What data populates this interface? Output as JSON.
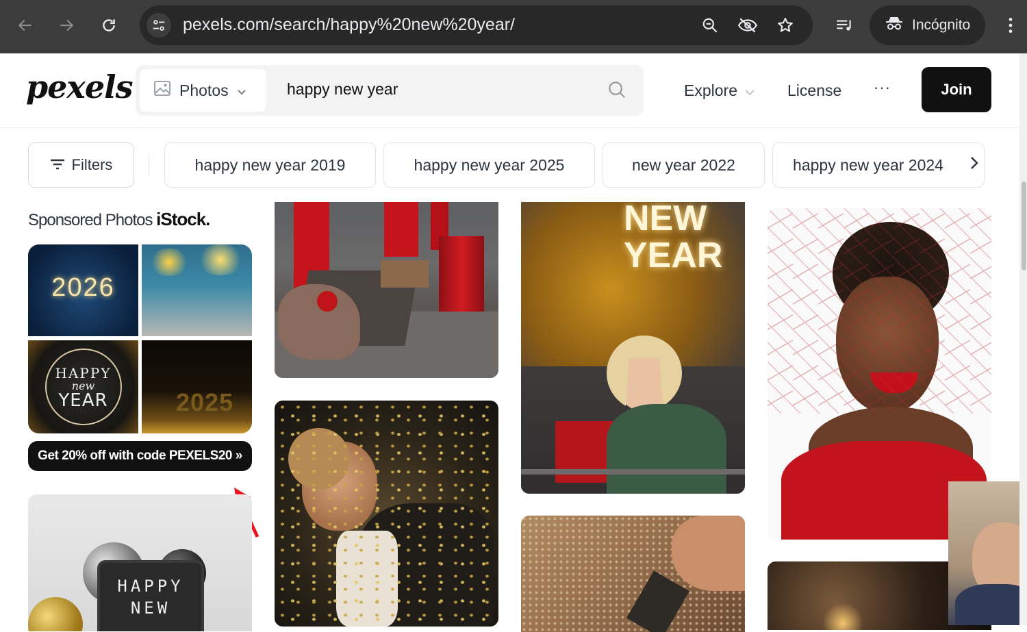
{
  "browser": {
    "url": "pexels.com/search/happy%20new%20year/",
    "incognito_label": "Incógnito",
    "icons": [
      "back-icon",
      "forward-icon",
      "reload-icon",
      "site-info-icon",
      "zoom-icon",
      "eye-off-icon",
      "star-icon",
      "media-queue-icon",
      "incognito-icon",
      "menu-kebab-icon"
    ]
  },
  "header": {
    "logo": "pexels",
    "search_type": "Photos",
    "search_query": "happy new year",
    "explore_label": "Explore",
    "license_label": "License",
    "more_label": "···",
    "join_label": "Join"
  },
  "chips": {
    "filters_label": "Filters",
    "items": [
      "happy new year 2019",
      "happy new year 2025",
      "new year 2022",
      "happy new year 2024"
    ]
  },
  "sponsored": {
    "label": "Sponsored Photos",
    "brand": "iStock.",
    "tile_texts": [
      "2026",
      "HAPPY",
      "new",
      "YEAR",
      "2025"
    ],
    "promo": "Get 20% off with code PEXELS20 »"
  },
  "photos": {
    "col1_sign_text_1": "HAPPY",
    "col1_sign_text_2": "NEW",
    "col3_neon_1": "NEW",
    "col3_neon_2": "YEAR"
  },
  "colors": {
    "chrome_bg": "#3c3c3c",
    "omnibox_bg": "#282828",
    "join_bg": "#111111",
    "promo_bg": "#111111"
  }
}
